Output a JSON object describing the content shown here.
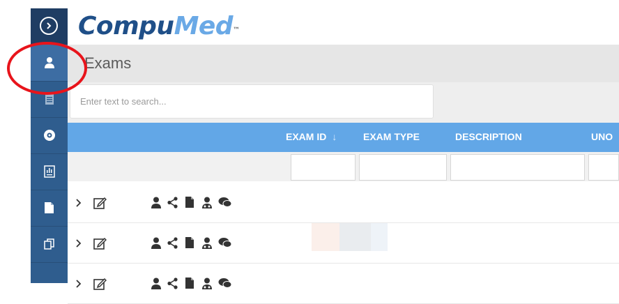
{
  "app": {
    "logo_part1": "Compu",
    "logo_part2": "Med",
    "logo_tm": "™"
  },
  "page": {
    "title": "Exams"
  },
  "search": {
    "placeholder": "Enter text to search..."
  },
  "grid": {
    "columns": [
      "EXAM ID",
      "EXAM TYPE",
      "DESCRIPTION",
      "UNO"
    ],
    "sort_indicator": "↓"
  },
  "sidebar": {
    "items": [
      "menu-toggle",
      "patient",
      "exam-list",
      "disc",
      "report",
      "document",
      "copy"
    ]
  },
  "row_actions": [
    "expand",
    "edit",
    "patient",
    "share",
    "document",
    "physician",
    "comments"
  ],
  "colors": {
    "sidebar": "#2f5d8e",
    "sidebar_active": "#3d6da3",
    "grid_header": "#62a7e7",
    "logo_dark": "#1f4f88",
    "logo_light": "#6aa9e6",
    "annotation": "#e8141b"
  }
}
